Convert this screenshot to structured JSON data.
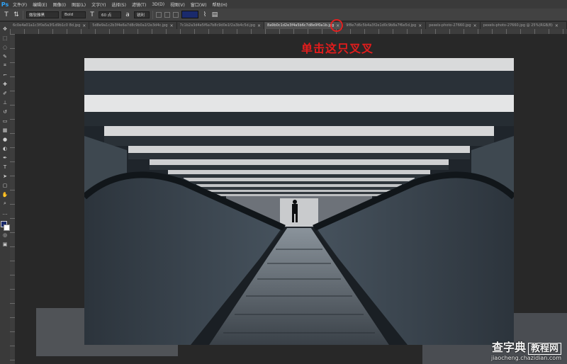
{
  "app": {
    "logo": "Ps"
  },
  "menu": [
    "文件(F)",
    "编辑(E)",
    "图像(I)",
    "图层(L)",
    "文字(Y)",
    "选择(S)",
    "滤镜(T)",
    "3D(D)",
    "视图(V)",
    "窗口(W)",
    "帮助(H)"
  ],
  "options": {
    "tool_icon": "T",
    "font_family": "微软雅黑",
    "font_style": "Bold",
    "font_size": "60 点",
    "antialias": "锐利"
  },
  "tabs": [
    {
      "label": "6c0e4a01a1c3f0a5a3f1d9b1c0 8d.jpg",
      "active": false
    },
    {
      "label": "5d8e9a1c2b3f4e6a7d8c9b0a1f2e3d4c.jpg",
      "active": false
    },
    {
      "label": "7c1b2a3d4e5f6a7b8c9d0e1f2a3b4c5d.jpg",
      "active": false
    },
    {
      "label": "8a9b0c1d2e3f4a5b6c7d8e9f0a1b.jpg",
      "active": true
    },
    {
      "label": "9f8e7d6c5b4a3f2e1d0c9b8a7f6e5d.jpg",
      "active": false
    },
    {
      "label": "pexels-photo-27660.jpg",
      "active": false
    },
    {
      "label": "pexels-photo-27660.jpg @ 25%(RGB/8)",
      "active": false
    }
  ],
  "annotation": {
    "text": "单击这只叉叉"
  },
  "watermark": {
    "main": "查字典",
    "box": "教程网",
    "sub": "jiaocheng.chazidian.com"
  }
}
